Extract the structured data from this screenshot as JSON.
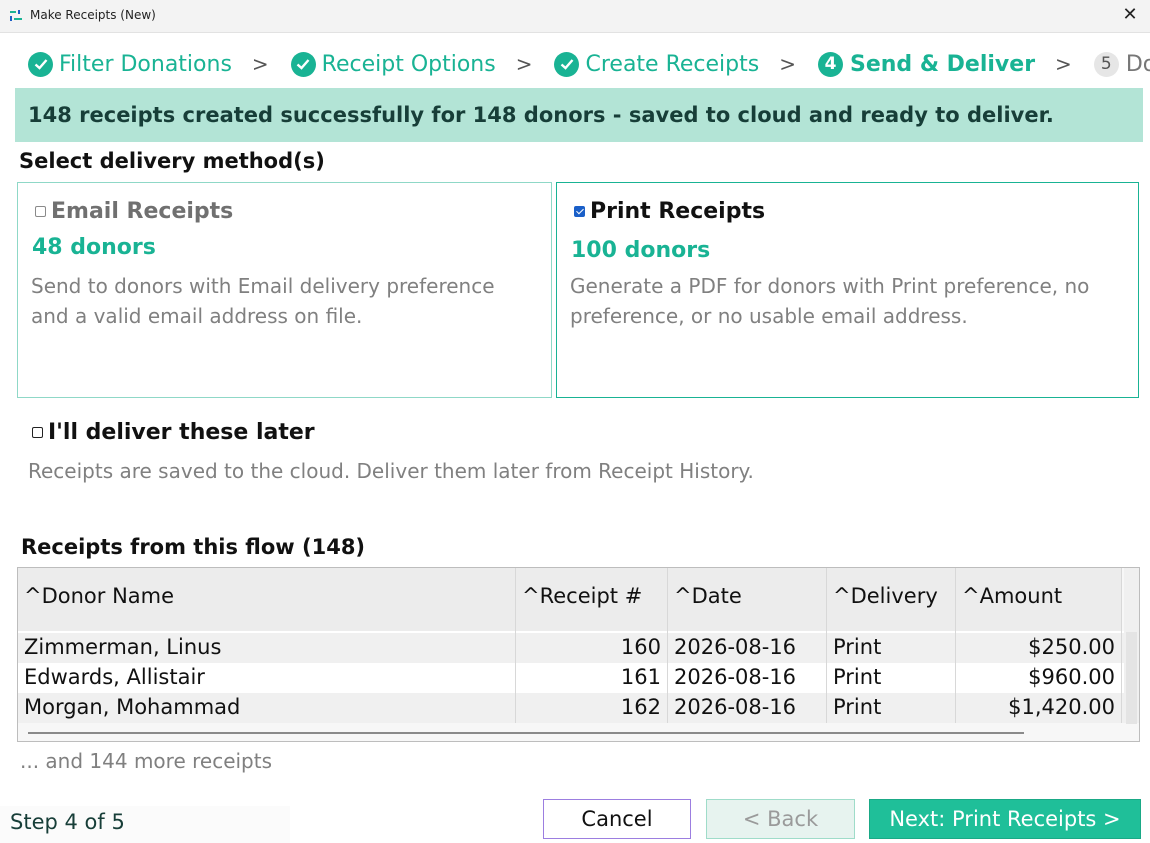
{
  "window": {
    "title": "Make Receipts (New)"
  },
  "steps": [
    {
      "label": "Filter Donations",
      "state": "done"
    },
    {
      "label": "Receipt Options",
      "state": "done"
    },
    {
      "label": "Create Receipts",
      "state": "done"
    },
    {
      "label": "Send & Deliver",
      "state": "current",
      "number": "4"
    },
    {
      "label": "Done",
      "state": "upcoming",
      "number": "5"
    }
  ],
  "step_separator": ">",
  "banner": "148 receipts created successfully for 148 donors - saved to cloud and ready to deliver.",
  "delivery": {
    "section_label": "Select delivery method(s)",
    "email": {
      "label": "Email Receipts",
      "checked": false,
      "count": "48 donors",
      "description": "Send to donors with Email delivery preference and a valid email address on file."
    },
    "print": {
      "label": "Print Receipts",
      "checked": true,
      "count": "100 donors",
      "description": "Generate a PDF for donors with Print preference, no preference, or no usable email address."
    },
    "later": {
      "label": "I'll deliver these later",
      "checked": false,
      "description": "Receipts are saved to the cloud. Deliver them later from Receipt History."
    }
  },
  "receipts_table": {
    "title": "Receipts from this flow (148)",
    "columns": [
      "^Donor Name",
      "^Receipt #",
      "^Date",
      "^Delivery",
      "^Amount"
    ],
    "rows": [
      {
        "name": "Zimmerman, Linus",
        "receipt": "160",
        "date": "2026-08-16",
        "delivery": "Print",
        "amount": "$250.00"
      },
      {
        "name": "Edwards, Allistair",
        "receipt": "161",
        "date": "2026-08-16",
        "delivery": "Print",
        "amount": "$960.00"
      },
      {
        "name": "Morgan, Mohammad",
        "receipt": "162",
        "date": "2026-08-16",
        "delivery": "Print",
        "amount": "$1,420.00"
      }
    ],
    "more_text": "... and 144 more receipts"
  },
  "footer": {
    "status": "Step 4 of 5",
    "cancel": "Cancel",
    "back": "< Back",
    "next": "Next: Print Receipts >"
  },
  "colors": {
    "accent": "#19b394",
    "banner_bg": "#b3e4d6",
    "checkbox_checked": "#1a5fc8"
  }
}
